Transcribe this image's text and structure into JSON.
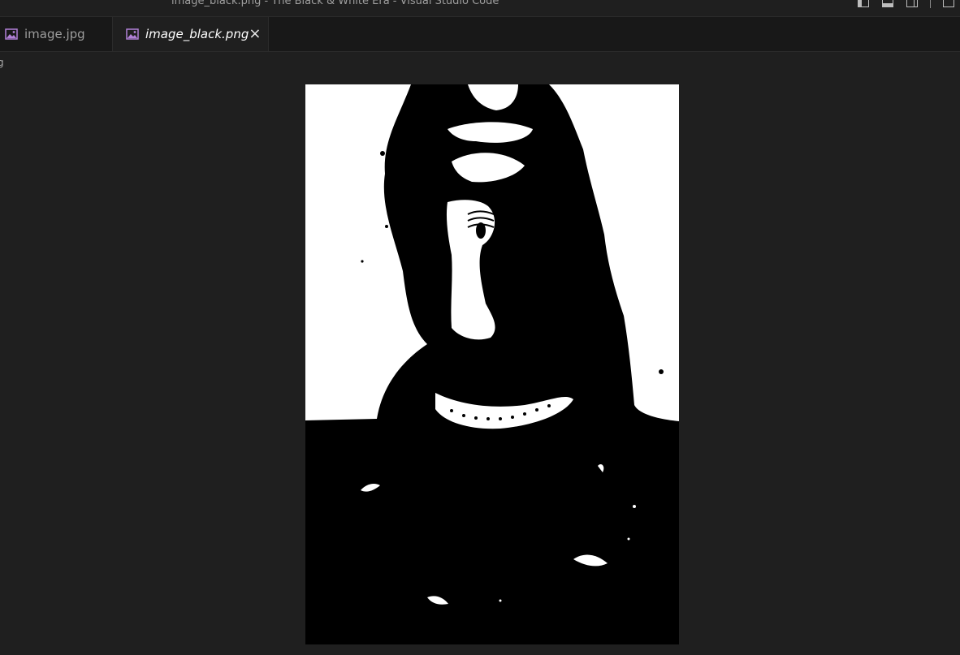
{
  "window": {
    "title": "image_black.png - The Black & White Era - Visual Studio Code"
  },
  "tabs": [
    {
      "label": "image.jpg",
      "icon": "image-file-icon",
      "active": false
    },
    {
      "label": "image_black.png",
      "icon": "image-file-icon",
      "active": true,
      "close_glyph": "×"
    }
  ],
  "breadcrumb": {
    "fragment": "g"
  },
  "colors": {
    "background": "#1f1f1f",
    "tab_inactive": "#181818",
    "image_icon": "#b180d7"
  }
}
